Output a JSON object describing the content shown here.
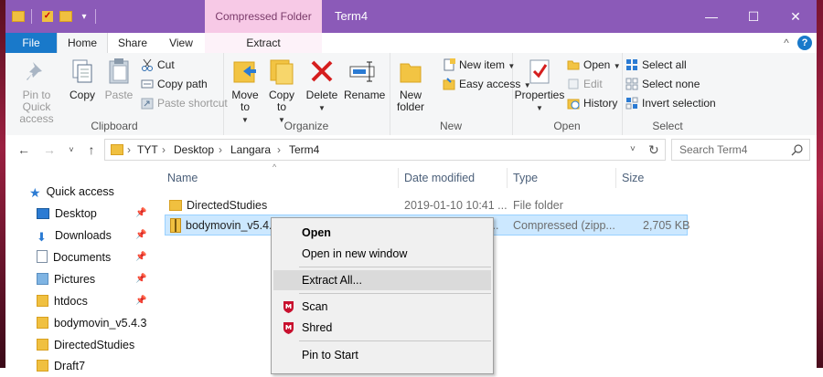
{
  "window": {
    "title": "Term4",
    "context_tab": "Compressed Folder Tools",
    "controls": {
      "minimize": "—",
      "maximize": "☐",
      "close": "✕"
    }
  },
  "tabs": {
    "file": "File",
    "home": "Home",
    "share": "Share",
    "view": "View",
    "extract": "Extract"
  },
  "help": {
    "collapse": "^",
    "help": "?"
  },
  "ribbon": {
    "clipboard": {
      "label": "Clipboard",
      "pin_quick_access": "Pin to Quick access",
      "copy": "Copy",
      "paste": "Paste",
      "cut": "Cut",
      "copy_path": "Copy path",
      "paste_shortcut": "Paste shortcut"
    },
    "organize": {
      "label": "Organize",
      "move_to": "Move to",
      "copy_to": "Copy to",
      "delete": "Delete",
      "rename": "Rename"
    },
    "new": {
      "label": "New",
      "new_folder": "New folder",
      "new_item": "New item",
      "easy_access": "Easy access"
    },
    "open": {
      "label": "Open",
      "properties": "Properties",
      "open": "Open",
      "edit": "Edit",
      "history": "History"
    },
    "select": {
      "label": "Select",
      "select_all": "Select all",
      "select_none": "Select none",
      "invert_selection": "Invert selection"
    }
  },
  "address": {
    "crumbs": [
      "TYT",
      "Desktop",
      "Langara",
      "Term4"
    ],
    "search_placeholder": "Search Term4"
  },
  "nav": {
    "quick_access": "Quick access",
    "items": [
      "Desktop",
      "Downloads",
      "Documents",
      "Pictures",
      "htdocs",
      "bodymovin_v5.4.3",
      "DirectedStudies",
      "Draft7"
    ]
  },
  "columns": {
    "name": "Name",
    "date": "Date modified",
    "type": "Type",
    "size": "Size"
  },
  "files": [
    {
      "name": "DirectedStudies",
      "date": "2019-01-10 10:41 ...",
      "type": "File folder",
      "size": ""
    },
    {
      "name": "bodymovin_v5.4.3",
      "date": "...",
      "type": "Compressed (zipp...",
      "size": "2,705 KB"
    }
  ],
  "context_menu": {
    "open": "Open",
    "open_new_window": "Open in new window",
    "extract_all": "Extract All...",
    "scan": "Scan",
    "shred": "Shred",
    "pin_to_start": "Pin to Start"
  },
  "colors": {
    "titlebar": "#8b5ab8",
    "context_tab": "#f7c9e6",
    "file_tab": "#1979ca",
    "selection": "#cce8ff",
    "mcafee": "#c8102e"
  }
}
